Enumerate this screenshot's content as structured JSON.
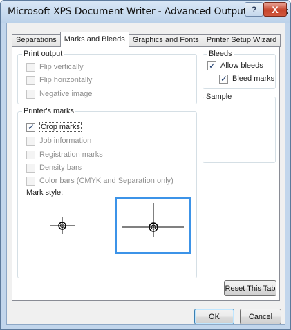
{
  "window": {
    "title": "Microsoft XPS Document Writer - Advanced Output Settings",
    "help_glyph": "?",
    "close_glyph": "X"
  },
  "tabs": [
    {
      "label": "Separations",
      "active": false
    },
    {
      "label": "Marks and Bleeds",
      "active": true
    },
    {
      "label": "Graphics and Fonts",
      "active": false
    },
    {
      "label": "Printer Setup Wizard",
      "active": false
    }
  ],
  "print_output": {
    "title": "Print output",
    "items": [
      {
        "label": "Flip vertically",
        "checked": false,
        "enabled": false
      },
      {
        "label": "Flip horizontally",
        "checked": false,
        "enabled": false
      },
      {
        "label": "Negative image",
        "checked": false,
        "enabled": false
      }
    ]
  },
  "bleeds": {
    "title": "Bleeds",
    "items": [
      {
        "label": "Allow bleeds",
        "checked": true,
        "enabled": true
      },
      {
        "label": "Bleed marks",
        "checked": true,
        "enabled": true
      }
    ]
  },
  "sample": {
    "title": "Sample"
  },
  "printers_marks": {
    "title": "Printer's marks",
    "items": [
      {
        "label": "Crop marks",
        "checked": true,
        "enabled": true
      },
      {
        "label": "Job information",
        "checked": false,
        "enabled": false
      },
      {
        "label": "Registration marks",
        "checked": false,
        "enabled": false
      },
      {
        "label": "Density bars",
        "checked": false,
        "enabled": false
      },
      {
        "label": "Color bars (CMYK and Separation only)",
        "checked": false,
        "enabled": false
      }
    ],
    "mark_style_label": "Mark style:",
    "mark_styles": [
      {
        "selected": false
      },
      {
        "selected": true
      }
    ]
  },
  "buttons": {
    "reset_tab": "Reset This Tab",
    "ok": "OK",
    "cancel": "Cancel"
  },
  "colors": {
    "selection_border": "#3c93e8",
    "close_button": "#c7452c"
  }
}
